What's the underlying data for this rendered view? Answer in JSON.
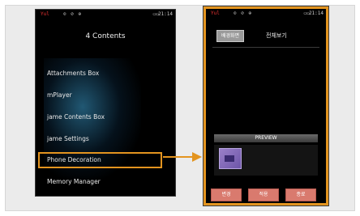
{
  "left_phone": {
    "status": {
      "signal": "Yul",
      "icons": "⊙ ⊘ ⊕",
      "battery": "▭▭",
      "time": "21:14"
    },
    "title": "4 Contents",
    "menu": [
      "Attachments Box",
      "mPlayer",
      "jame Contents Box",
      "jame Settings",
      "Phone Decoration",
      "Memory Manager"
    ],
    "selected_index": 4
  },
  "right_phone": {
    "status": {
      "signal": "Yul",
      "icons": "⊙ ⊘ ⊕",
      "battery": "▭▭",
      "time": "21:14"
    },
    "tab_active": "배경화면",
    "tab_label": "전체보기",
    "preview_bar": "PREVIEW",
    "buttons": [
      "변경",
      "적용",
      "종료"
    ]
  },
  "colors": {
    "accent": "#e3941f",
    "button": "#d97a6e"
  }
}
